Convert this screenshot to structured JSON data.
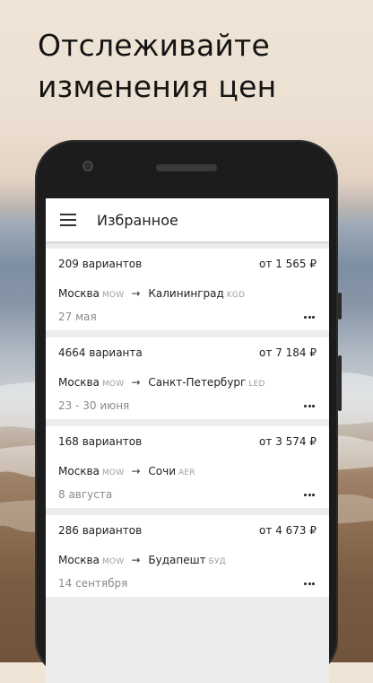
{
  "headline": "Отслеживайте изменения цен",
  "app": {
    "title": "Избранное",
    "icons": {
      "menu": "hamburger-menu-icon",
      "more": "more-horizontal-icon"
    }
  },
  "favorites": [
    {
      "variants": "209 вариантов",
      "price": "от 1 565 ₽",
      "from_city": "Москва",
      "from_code": "MOW",
      "arrow": "→",
      "to_city": "Калининград",
      "to_code": "KGD",
      "dates": "27 мая"
    },
    {
      "variants": "4664 варианта",
      "price": "от 7 184 ₽",
      "from_city": "Москва",
      "from_code": "MOW",
      "arrow": "→",
      "to_city": "Санкт-Петербург",
      "to_code": "LED",
      "dates": "23 - 30 июня"
    },
    {
      "variants": "168 вариантов",
      "price": "от 3 574 ₽",
      "from_city": "Москва",
      "from_code": "MOW",
      "arrow": "→",
      "to_city": "Сочи",
      "to_code": "AER",
      "dates": "8 августа"
    },
    {
      "variants": "286 вариантов",
      "price": "от 4 673 ₽",
      "from_city": "Москва",
      "from_code": "MOW",
      "arrow": "→",
      "to_city": "Будапешт",
      "to_code": "БУД",
      "dates": "14 сентября"
    }
  ],
  "colors": {
    "headline": "#141414",
    "phone_frame": "#1c1c1c",
    "screen_bg": "#ececec",
    "card_bg": "#ffffff",
    "muted_text": "#8a8a8a",
    "code_text": "#9e9e9e"
  }
}
